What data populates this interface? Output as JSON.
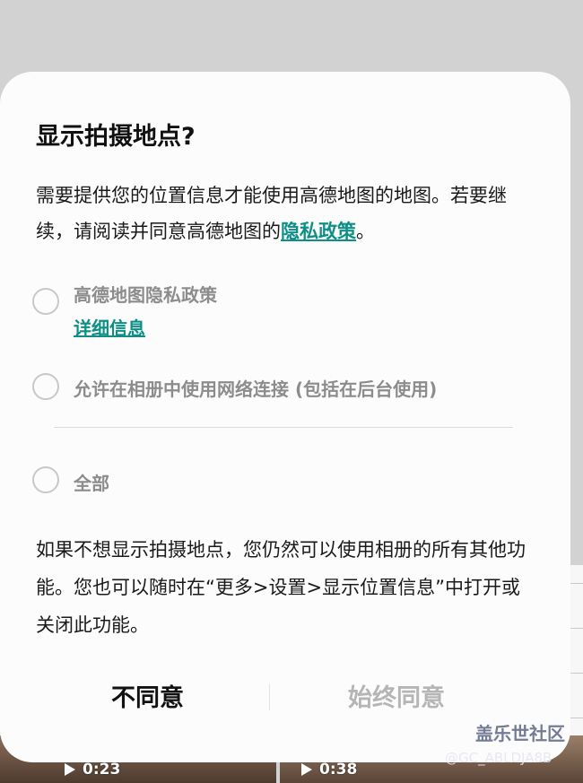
{
  "dialog": {
    "title": "显示拍摄地点?",
    "desc_part1": "需要提供您的位置信息才能使用高德地图的地图。若要继续，请阅读并同意高德地图的",
    "desc_link": "隐私政策",
    "desc_end": "。",
    "options": [
      {
        "label": "高德地图隐私政策",
        "sub_link": "详细信息",
        "checked": false
      },
      {
        "label": "允许在相册中使用网络连接 (包括在后台使用)",
        "checked": false
      },
      {
        "label": "全部",
        "checked": false
      }
    ],
    "note": "如果不想显示拍摄地点，您仍然可以使用相册的所有其他功能。您也可以随时在“更多>设置>显示位置信息”中打开或关闭此功能。",
    "buttons": {
      "disagree": "不同意",
      "agree": "始终同意"
    }
  },
  "background": {
    "video1_duration": "0:23",
    "video2_duration": "0:38"
  },
  "watermark": {
    "brand": "盖乐世社区",
    "user": "@GC_ABLDJA8B"
  },
  "colors": {
    "accent": "#0d8f86",
    "dialog_bg": "#fcfcfc",
    "disabled_text": "#b5b5b5"
  }
}
